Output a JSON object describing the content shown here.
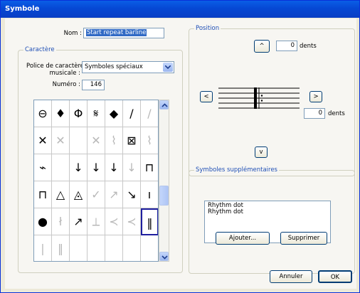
{
  "window": {
    "title": "Symbole"
  },
  "nom": {
    "label": "Nom :",
    "value": "Start repeat barline"
  },
  "caractere": {
    "legend": "Caractère",
    "font_label_1": "Police de caractère",
    "font_label_2": "musicale :",
    "font_value": "Symboles spéciaux",
    "numero_label": "Numéro :",
    "numero_value": "146"
  },
  "grid": {
    "cells": [
      "⊖",
      "♦",
      "Φ",
      "𝄋",
      "◆",
      "/",
      "/",
      "✕",
      "✕",
      "",
      "✕",
      "⌇",
      "⊠",
      "⌇",
      "⌁",
      "",
      "↓",
      "↓",
      "↓",
      "↓",
      "⊓",
      "⊓",
      "△",
      "◬",
      "✓",
      "↗",
      "↘",
      "ı",
      "●",
      "ł",
      "↗",
      "⟂",
      "≺",
      "≺",
      "‖",
      "|",
      "‖",
      "",
      "",
      "",
      "",
      ""
    ],
    "faint": [
      6,
      8,
      9,
      10,
      11,
      13,
      19,
      24,
      25,
      29,
      31,
      32,
      33,
      35,
      36
    ]
  },
  "position": {
    "legend": "Position",
    "vertical_value": "0",
    "vertical_unit": "dents",
    "horizontal_value": "0",
    "horizontal_unit": "dents",
    "up_label": "^",
    "down_label": "v",
    "left_label": "<",
    "right_label": ">"
  },
  "extra": {
    "legend": "Symboles supplémentaires",
    "items": [
      "Rhythm dot",
      "Rhythm dot"
    ],
    "add_label": "Ajouter...",
    "remove_label": "Supprimer"
  },
  "footer": {
    "cancel_label": "Annuler",
    "ok_label": "OK"
  }
}
